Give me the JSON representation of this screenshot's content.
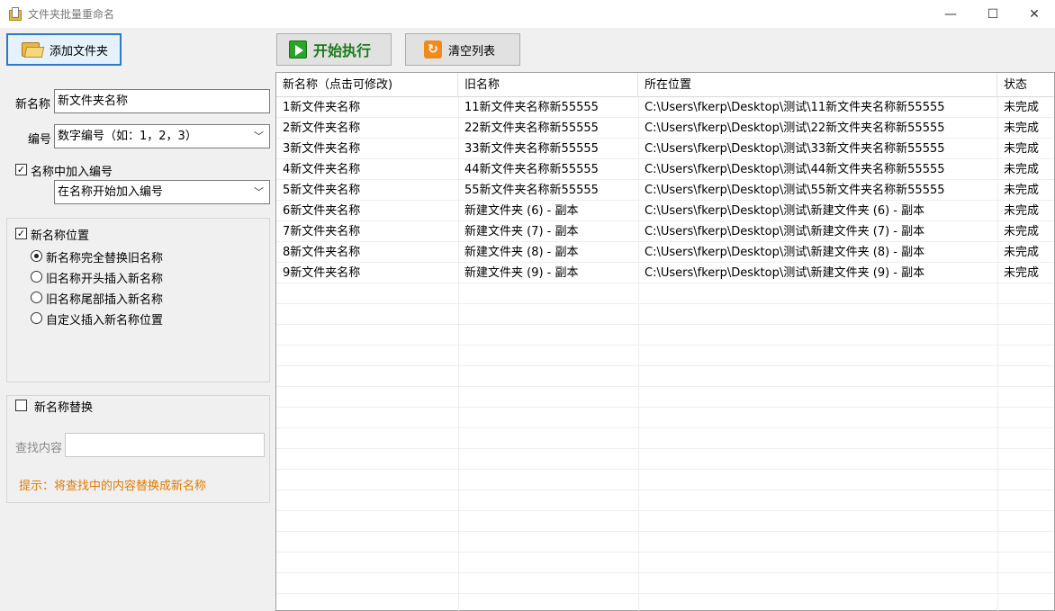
{
  "window": {
    "title": "文件夹批量重命名",
    "minimize": "—",
    "maximize": "☐",
    "close": "✕"
  },
  "toolbar": {
    "add_folder_label": "添加文件夹",
    "start_label": "开始执行",
    "clear_label": "清空列表"
  },
  "form": {
    "new_name_label": "新名称",
    "new_name_value": "新文件夹名称",
    "numbering_label": "编号",
    "numbering_value": "数字编号（如：1，2，3）",
    "add_number_checkbox_label": "名称中加入编号",
    "add_number_checked": true,
    "number_position_value": "在名称开始加入编号",
    "position_group_label": "新名称位置",
    "position_group_checked": true,
    "position_options": [
      {
        "label": "新名称完全替换旧名称",
        "selected": true
      },
      {
        "label": "旧名称开头插入新名称",
        "selected": false
      },
      {
        "label": "旧名称尾部插入新名称",
        "selected": false
      },
      {
        "label": "自定义插入新名称位置",
        "selected": false
      }
    ],
    "replace_group_label": "新名称替换",
    "replace_checked": false,
    "find_label": "查找内容",
    "find_value": "",
    "hint": "提示：将查找中的内容替换成新名称"
  },
  "table": {
    "columns": [
      "新名称（点击可修改)",
      "旧名称",
      "所在位置",
      "状态"
    ],
    "rows": [
      [
        "1新文件夹名称",
        "11新文件夹名称新55555",
        "C:\\Users\\fkerp\\Desktop\\测试\\11新文件夹名称新55555",
        "未完成"
      ],
      [
        "2新文件夹名称",
        "22新文件夹名称新55555",
        "C:\\Users\\fkerp\\Desktop\\测试\\22新文件夹名称新55555",
        "未完成"
      ],
      [
        "3新文件夹名称",
        "33新文件夹名称新55555",
        "C:\\Users\\fkerp\\Desktop\\测试\\33新文件夹名称新55555",
        "未完成"
      ],
      [
        "4新文件夹名称",
        "44新文件夹名称新55555",
        "C:\\Users\\fkerp\\Desktop\\测试\\44新文件夹名称新55555",
        "未完成"
      ],
      [
        "5新文件夹名称",
        "55新文件夹名称新55555",
        "C:\\Users\\fkerp\\Desktop\\测试\\55新文件夹名称新55555",
        "未完成"
      ],
      [
        "6新文件夹名称",
        "新建文件夹 (6) - 副本",
        "C:\\Users\\fkerp\\Desktop\\测试\\新建文件夹 (6) - 副本",
        "未完成"
      ],
      [
        "7新文件夹名称",
        "新建文件夹 (7) - 副本",
        "C:\\Users\\fkerp\\Desktop\\测试\\新建文件夹 (7) - 副本",
        "未完成"
      ],
      [
        "8新文件夹名称",
        "新建文件夹 (8) - 副本",
        "C:\\Users\\fkerp\\Desktop\\测试\\新建文件夹 (8) - 副本",
        "未完成"
      ],
      [
        "9新文件夹名称",
        "新建文件夹 (9) - 副本",
        "C:\\Users\\fkerp\\Desktop\\测试\\新建文件夹 (9) - 副本",
        "未完成"
      ]
    ]
  }
}
